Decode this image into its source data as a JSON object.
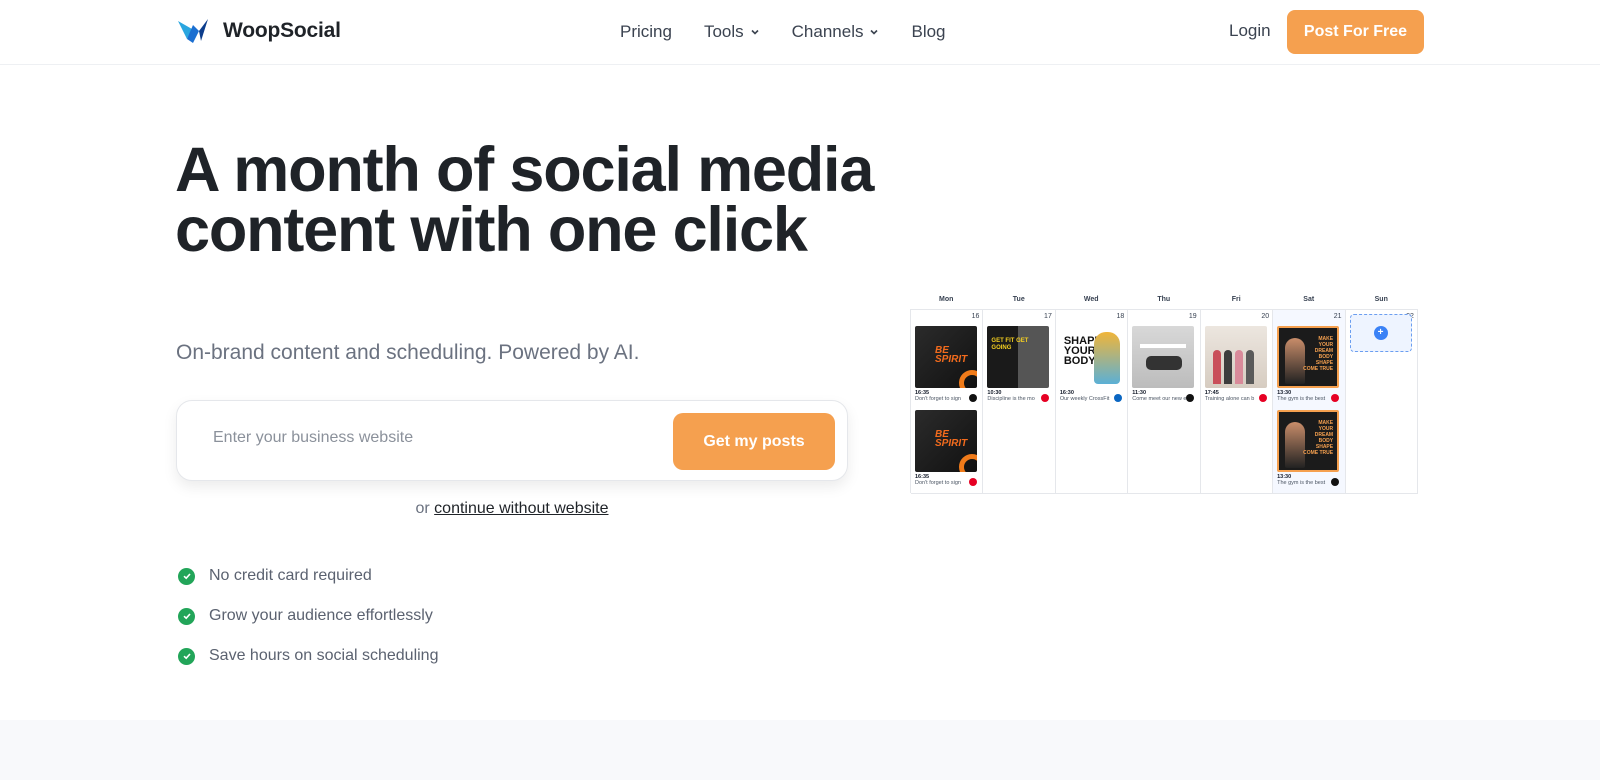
{
  "brand": {
    "name": "WoopSocial"
  },
  "nav": {
    "items": [
      {
        "label": "Pricing",
        "dropdown": false
      },
      {
        "label": "Tools",
        "dropdown": true
      },
      {
        "label": "Channels",
        "dropdown": true
      },
      {
        "label": "Blog",
        "dropdown": false
      }
    ],
    "login_label": "Login",
    "cta_label": "Post For Free"
  },
  "hero": {
    "title": "A month of social media content with one click",
    "subtitle": "On-brand content and scheduling. Powered by AI.",
    "search": {
      "placeholder": "Enter your business website",
      "value": "",
      "button_label": "Get my posts"
    },
    "alt": {
      "prefix": "or",
      "link_label": "continue without website"
    },
    "features": [
      "No credit card required",
      "Grow your audience effortlessly",
      "Save hours on social scheduling"
    ]
  },
  "calendar": {
    "days": [
      {
        "name": "Mon",
        "date": "16"
      },
      {
        "name": "Tue",
        "date": "17"
      },
      {
        "name": "Wed",
        "date": "18"
      },
      {
        "name": "Thu",
        "date": "19"
      },
      {
        "name": "Fri",
        "date": "20"
      },
      {
        "name": "Sat",
        "date": "21"
      },
      {
        "name": "Sun",
        "date": "22"
      }
    ],
    "posts": {
      "mon_1": {
        "time": "16:35",
        "caption": "Don't forget to sign",
        "image_text": "BE SPIRIT",
        "network": "x"
      },
      "mon_2": {
        "time": "16:35",
        "caption": "Don't forget to sign",
        "image_text": "BE SPIRIT",
        "network": "pinterest"
      },
      "tue_1": {
        "time": "10:30",
        "caption": "Discipline is the mo",
        "image_text": "GET FIT GET GOING",
        "network": "pinterest"
      },
      "wed_1": {
        "time": "16:30",
        "caption": "Our weekly CrossFit",
        "image_text": "SHAPE YOUR BODY",
        "network": "linkedin"
      },
      "thu_1": {
        "time": "11:30",
        "caption": "Come meet our new e",
        "network": "x"
      },
      "fri_1": {
        "time": "17:45",
        "caption": "Training alone can b",
        "network": "pinterest"
      },
      "sat_1": {
        "time": "13:30",
        "caption": "The gym is the best",
        "image_text": "MAKE YOUR DREAM BODY SHAPE COME TRUE",
        "network": "pinterest"
      },
      "sat_2": {
        "time": "13:30",
        "caption": "The gym is the best",
        "image_text": "MAKE YOUR DREAM BODY SHAPE COME TRUE",
        "network": "x"
      }
    },
    "add_label": "+"
  },
  "colors": {
    "accent": "#f5a04f",
    "check": "#22a559",
    "text_dark": "#1f2328",
    "text_muted": "#6b7280"
  }
}
